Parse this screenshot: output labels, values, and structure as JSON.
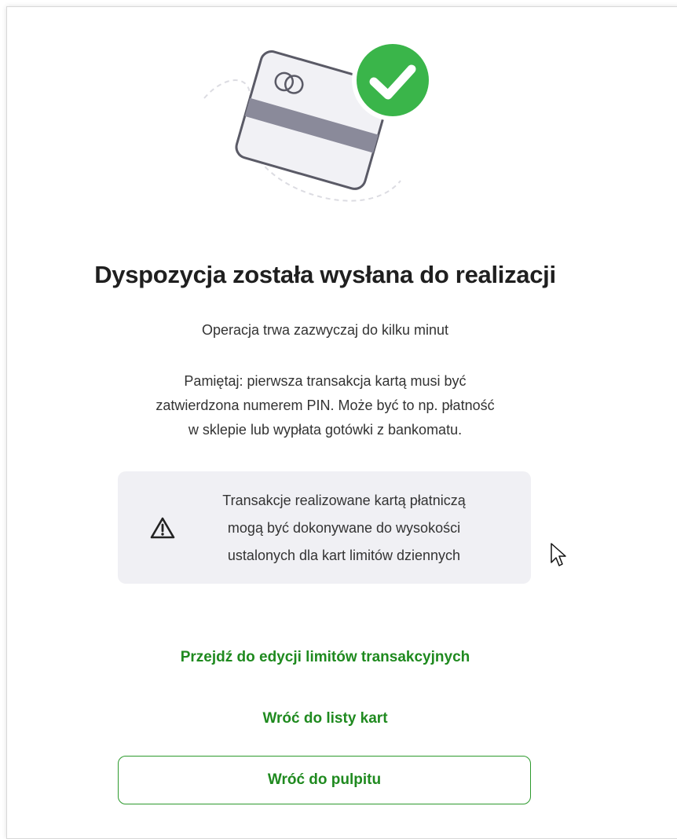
{
  "colors": {
    "accent_green": "#1f8a1f",
    "success_badge": "#3ab54a",
    "notice_background": "#f0f0f4"
  },
  "illustration": {
    "card_icon": "credit-card-icon",
    "badge_icon": "checkmark-icon"
  },
  "title": "Dyspozycja została wysłana do realizacji",
  "subtitle": "Operacja trwa zazwyczaj do kilku minut",
  "reminder": {
    "line1": "Pamiętaj: pierwsza transakcja kartą musi być",
    "line2": "zatwierdzona numerem PIN. Może być to np. płatność",
    "line3": "w sklepie lub wypłata gotówki z bankomatu."
  },
  "notice": {
    "icon": "warning-icon",
    "line1": "Transakcje realizowane kartą płatniczą",
    "line2": "mogą być dokonywane do wysokości",
    "line3": "ustalonych dla kart limitów dziennych"
  },
  "actions": {
    "limits_link": "Przejdź do edycji limitów transakcyjnych",
    "cards_link": "Wróć do listy kart",
    "dashboard_button": "Wróć do pulpitu"
  }
}
